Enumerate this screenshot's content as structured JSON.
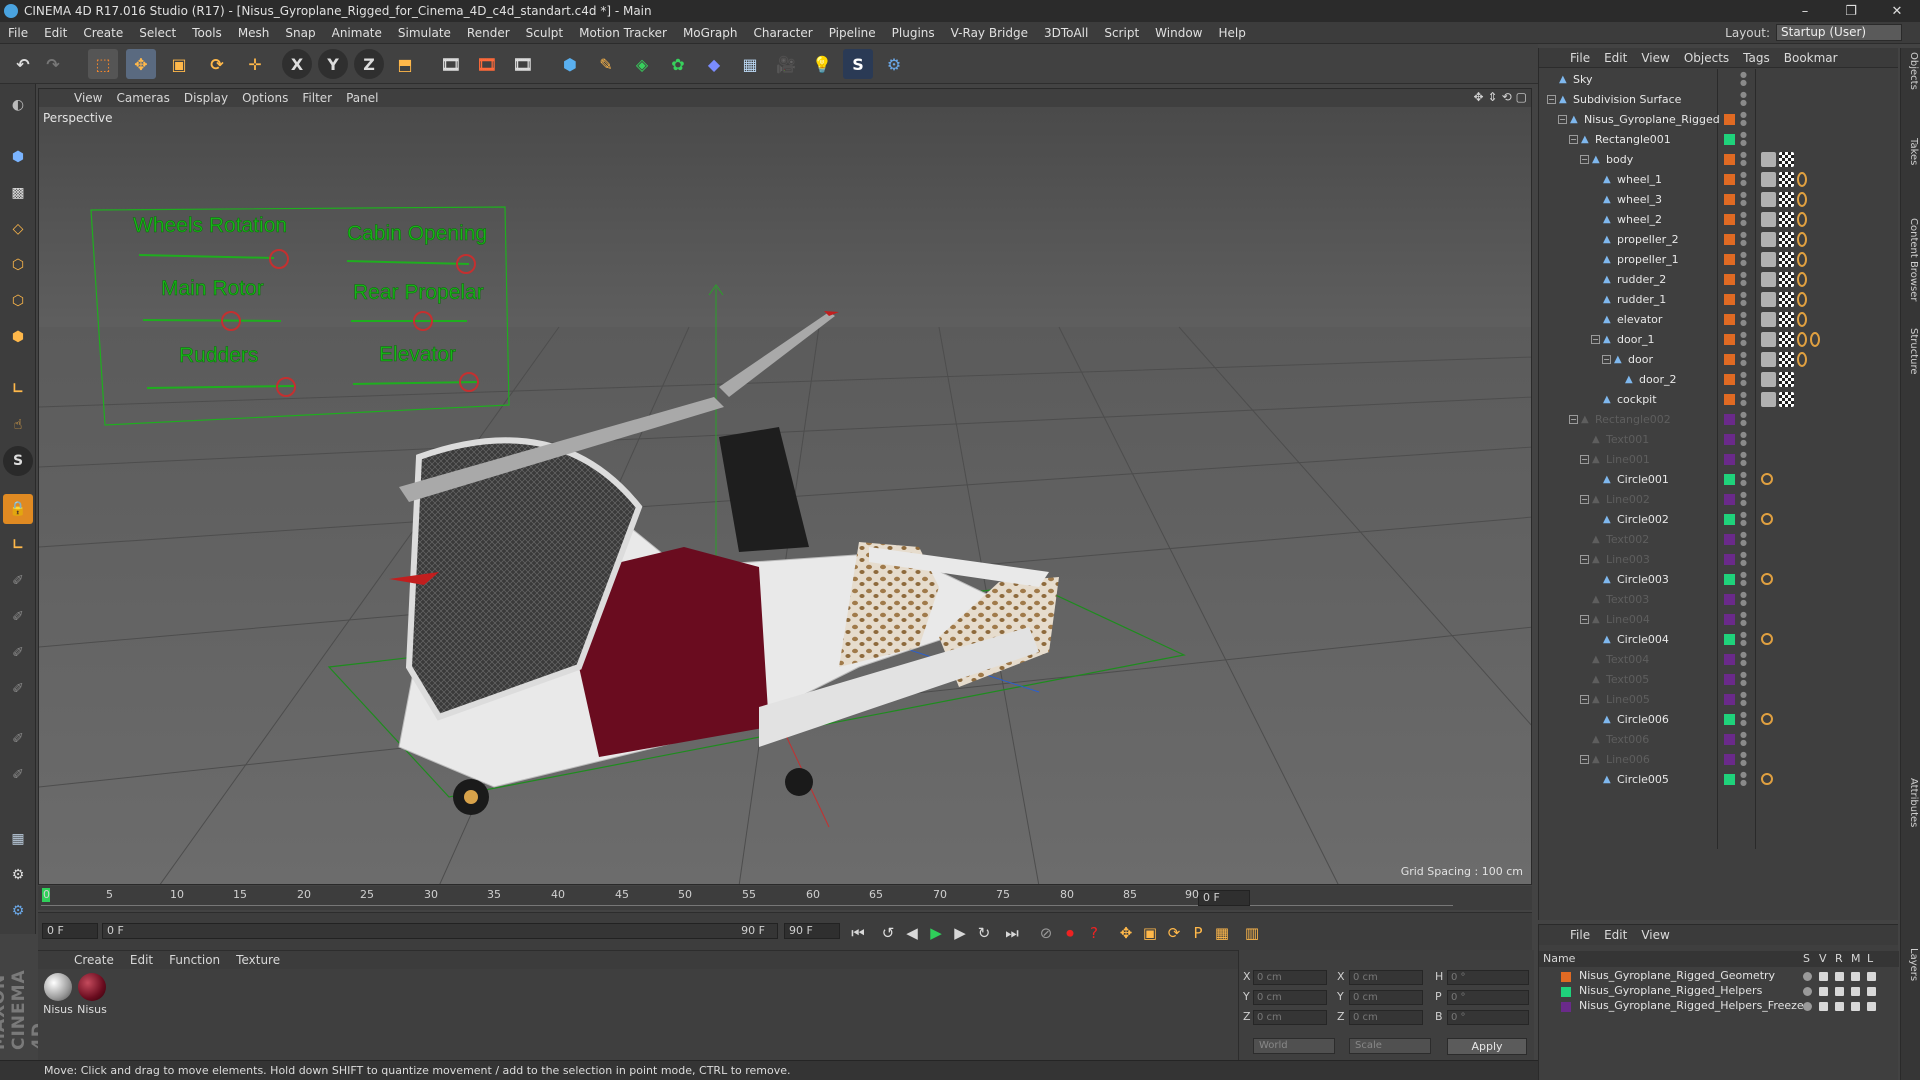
{
  "titlebar": {
    "title": "CINEMA 4D R17.016 Studio (R17) - [Nisus_Gyroplane_Rigged_for_Cinema_4D_c4d_standart.c4d *] - Main",
    "minimize": "–",
    "maximize": "❐",
    "close": "✕"
  },
  "menubar": {
    "items": [
      "File",
      "Edit",
      "Create",
      "Select",
      "Tools",
      "Mesh",
      "Snap",
      "Animate",
      "Simulate",
      "Render",
      "Sculpt",
      "Motion Tracker",
      "MoGraph",
      "Character",
      "Pipeline",
      "Plugins",
      "V-Ray Bridge",
      "3DToAll",
      "Script",
      "Window",
      "Help"
    ]
  },
  "layout": {
    "label": "Layout:",
    "value": "Startup (User)"
  },
  "viewport": {
    "menu": [
      "View",
      "Cameras",
      "Display",
      "Options",
      "Filter",
      "Panel"
    ],
    "label": "Perspective",
    "grid_spacing": "Grid Spacing : 100 cm",
    "hud_labels": [
      "Wheels Rotation",
      "Cabin Opening",
      "Main Rotor",
      "Rear Propelar",
      "Rudders",
      "Elevator"
    ]
  },
  "timeline": {
    "ticks": [
      "0",
      "5",
      "10",
      "15",
      "20",
      "25",
      "30",
      "35",
      "40",
      "45",
      "50",
      "55",
      "60",
      "65",
      "70",
      "75",
      "80",
      "85",
      "90"
    ],
    "current_frame": "0 F"
  },
  "transport": {
    "start": "0 F",
    "slider": "0 F",
    "end_inner": "90 F",
    "end": "90 F"
  },
  "materials": {
    "menu": [
      "Create",
      "Edit",
      "Function",
      "Texture"
    ],
    "items": [
      {
        "name": "Nisus"
      },
      {
        "name": "Nisus"
      }
    ]
  },
  "coords": {
    "rows": [
      {
        "a": "X",
        "av": "0 cm",
        "b": "X",
        "bv": "0 cm",
        "c": "H",
        "cv": "0 °"
      },
      {
        "a": "Y",
        "av": "0 cm",
        "b": "Y",
        "bv": "0 cm",
        "c": "P",
        "cv": "0 °"
      },
      {
        "a": "Z",
        "av": "0 cm",
        "b": "Z",
        "bv": "0 cm",
        "c": "B",
        "cv": "0 °"
      }
    ],
    "mode": "World",
    "scale": "Scale",
    "apply": "Apply"
  },
  "statusbar": {
    "text": "Move: Click and drag to move elements. Hold down SHIFT to quantize movement / add to the selection in point mode, CTRL to remove."
  },
  "objects": {
    "menu": [
      "File",
      "Edit",
      "View",
      "Objects",
      "Tags",
      "Bookmar"
    ],
    "items": [
      {
        "name": "Sky",
        "depth": 0,
        "dim": false,
        "layer": "",
        "tags": 0
      },
      {
        "name": "Subdivision Surface",
        "depth": 0,
        "dim": false,
        "layer": "",
        "tags": 0
      },
      {
        "name": "Nisus_Gyroplane_Rigged",
        "depth": 1,
        "dim": false,
        "layer": "#e06a23",
        "tags": 0
      },
      {
        "name": "Rectangle001",
        "depth": 2,
        "dim": false,
        "layer": "#1fd27b",
        "tags": 0
      },
      {
        "name": "body",
        "depth": 3,
        "dim": false,
        "layer": "#e06a23",
        "tags": 2
      },
      {
        "name": "wheel_1",
        "depth": 4,
        "dim": false,
        "layer": "#e06a23",
        "tags": 3
      },
      {
        "name": "wheel_3",
        "depth": 4,
        "dim": false,
        "layer": "#e06a23",
        "tags": 3
      },
      {
        "name": "wheel_2",
        "depth": 4,
        "dim": false,
        "layer": "#e06a23",
        "tags": 3
      },
      {
        "name": "propeller_2",
        "depth": 4,
        "dim": false,
        "layer": "#e06a23",
        "tags": 3
      },
      {
        "name": "propeller_1",
        "depth": 4,
        "dim": false,
        "layer": "#e06a23",
        "tags": 3
      },
      {
        "name": "rudder_2",
        "depth": 4,
        "dim": false,
        "layer": "#e06a23",
        "tags": 3
      },
      {
        "name": "rudder_1",
        "depth": 4,
        "dim": false,
        "layer": "#e06a23",
        "tags": 3
      },
      {
        "name": "elevator",
        "depth": 4,
        "dim": false,
        "layer": "#e06a23",
        "tags": 3
      },
      {
        "name": "door_1",
        "depth": 4,
        "dim": false,
        "layer": "#e06a23",
        "tags": 4
      },
      {
        "name": "door",
        "depth": 5,
        "dim": false,
        "layer": "#e06a23",
        "tags": 3
      },
      {
        "name": "door_2",
        "depth": 6,
        "dim": false,
        "layer": "#e06a23",
        "tags": 2
      },
      {
        "name": "cockpit",
        "depth": 4,
        "dim": false,
        "layer": "#e06a23",
        "tags": 2
      },
      {
        "name": "Rectangle002",
        "depth": 2,
        "dim": true,
        "layer": "#6a2a8a",
        "tags": 0
      },
      {
        "name": "Text001",
        "depth": 3,
        "dim": true,
        "layer": "#6a2a8a",
        "tags": 0
      },
      {
        "name": "Line001",
        "depth": 3,
        "dim": true,
        "layer": "#6a2a8a",
        "tags": 0
      },
      {
        "name": "Circle001",
        "depth": 4,
        "dim": false,
        "layer": "#1fd27b",
        "tags": 1
      },
      {
        "name": "Line002",
        "depth": 3,
        "dim": true,
        "layer": "#6a2a8a",
        "tags": 0
      },
      {
        "name": "Circle002",
        "depth": 4,
        "dim": false,
        "layer": "#1fd27b",
        "tags": 1
      },
      {
        "name": "Text002",
        "depth": 3,
        "dim": true,
        "layer": "#6a2a8a",
        "tags": 0
      },
      {
        "name": "Line003",
        "depth": 3,
        "dim": true,
        "layer": "#6a2a8a",
        "tags": 0
      },
      {
        "name": "Circle003",
        "depth": 4,
        "dim": false,
        "layer": "#1fd27b",
        "tags": 1
      },
      {
        "name": "Text003",
        "depth": 3,
        "dim": true,
        "layer": "#6a2a8a",
        "tags": 0
      },
      {
        "name": "Line004",
        "depth": 3,
        "dim": true,
        "layer": "#6a2a8a",
        "tags": 0
      },
      {
        "name": "Circle004",
        "depth": 4,
        "dim": false,
        "layer": "#1fd27b",
        "tags": 1
      },
      {
        "name": "Text004",
        "depth": 3,
        "dim": true,
        "layer": "#6a2a8a",
        "tags": 0
      },
      {
        "name": "Text005",
        "depth": 3,
        "dim": true,
        "layer": "#6a2a8a",
        "tags": 0
      },
      {
        "name": "Line005",
        "depth": 3,
        "dim": true,
        "layer": "#6a2a8a",
        "tags": 0
      },
      {
        "name": "Circle006",
        "depth": 4,
        "dim": false,
        "layer": "#1fd27b",
        "tags": 1
      },
      {
        "name": "Text006",
        "depth": 3,
        "dim": true,
        "layer": "#6a2a8a",
        "tags": 0
      },
      {
        "name": "Line006",
        "depth": 3,
        "dim": true,
        "layer": "#6a2a8a",
        "tags": 0
      },
      {
        "name": "Circle005",
        "depth": 4,
        "dim": false,
        "layer": "#1fd27b",
        "tags": 1
      }
    ]
  },
  "layers": {
    "menu": [
      "File",
      "Edit",
      "View"
    ],
    "header": {
      "name": "Name",
      "cols": [
        "S",
        "V",
        "R",
        "M",
        "L"
      ]
    },
    "items": [
      {
        "name": "Nisus_Gyroplane_Rigged_Geometry",
        "color": "#e06a23"
      },
      {
        "name": "Nisus_Gyroplane_Rigged_Helpers",
        "color": "#1fd27b"
      },
      {
        "name": "Nisus_Gyroplane_Rigged_Helpers_Freeze",
        "color": "#6a2a8a"
      }
    ]
  },
  "sidetabs": [
    "Objects",
    "Takes",
    "Content Browser",
    "Structure",
    "Attributes",
    "Layers"
  ],
  "branding": {
    "maxon": "MAXON CINEMA 4D"
  }
}
